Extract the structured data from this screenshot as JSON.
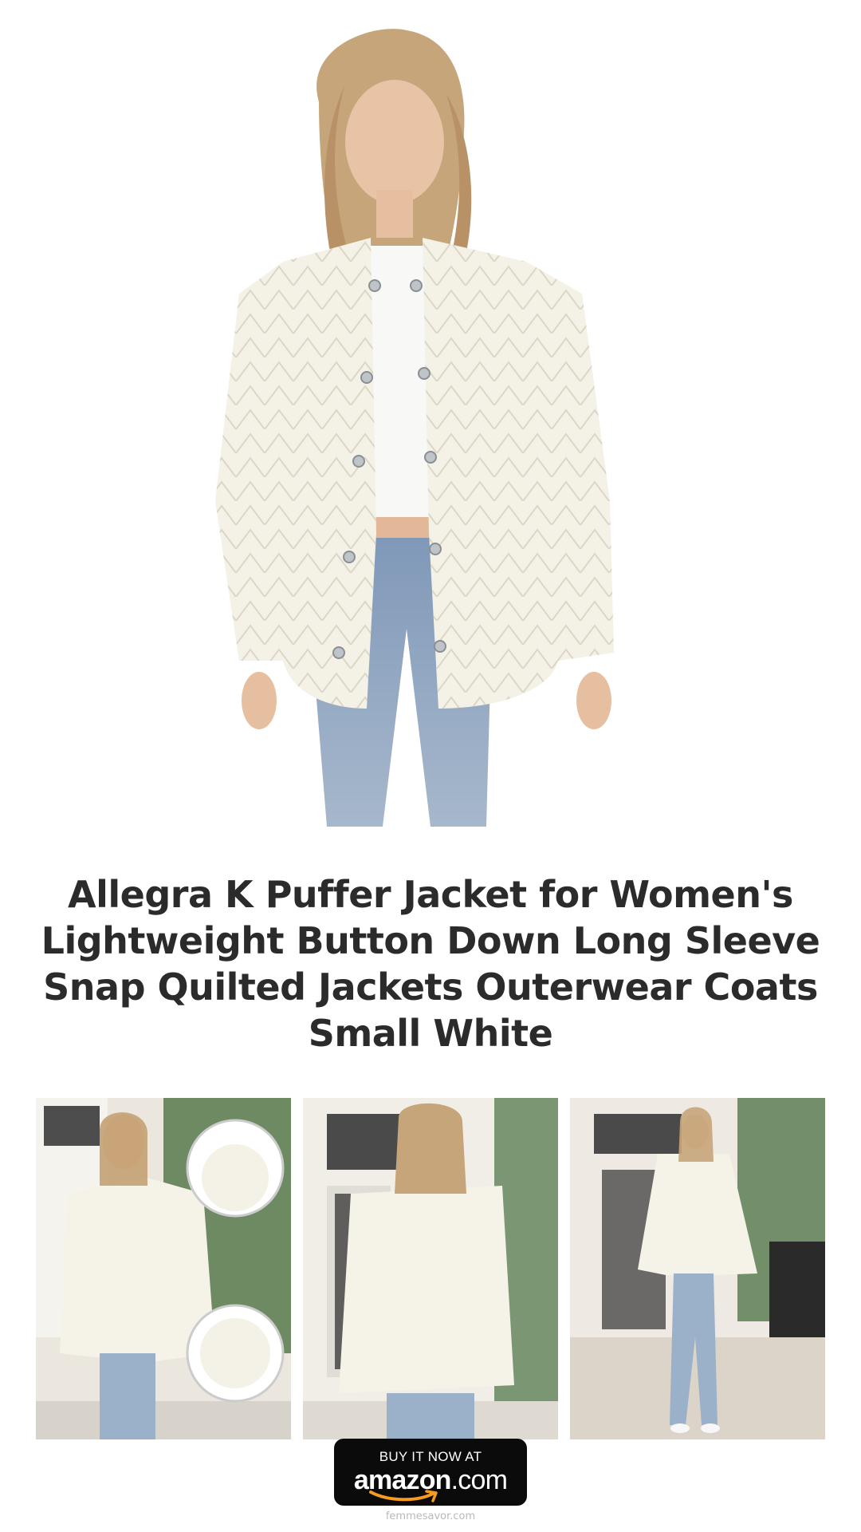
{
  "product": {
    "title": "Allegra K Puffer Jacket for Women's Lightweight Button Down Long Sleeve Snap Quilted Jackets Outerwear Coats Small White",
    "hero_image": "model-wearing-white-quilted-jacket",
    "thumbnails": [
      {
        "image": "front-view-with-detail-insets"
      },
      {
        "image": "back-view"
      },
      {
        "image": "full-length-front-view"
      }
    ]
  },
  "cta": {
    "top_text": "BUY IT NOW AT",
    "brand": "amazon",
    "brand_suffix": ".com",
    "icon": "amazon-smile-icon"
  },
  "footer": {
    "domain": "femmesavor.com"
  },
  "colors": {
    "background": "#ffffff",
    "title": "#2b2b2b",
    "button": "#0b0b0b",
    "amazon_orange": "#f79a1e",
    "jacket": "#f4f1e6",
    "denim": "#8fa6c2"
  }
}
